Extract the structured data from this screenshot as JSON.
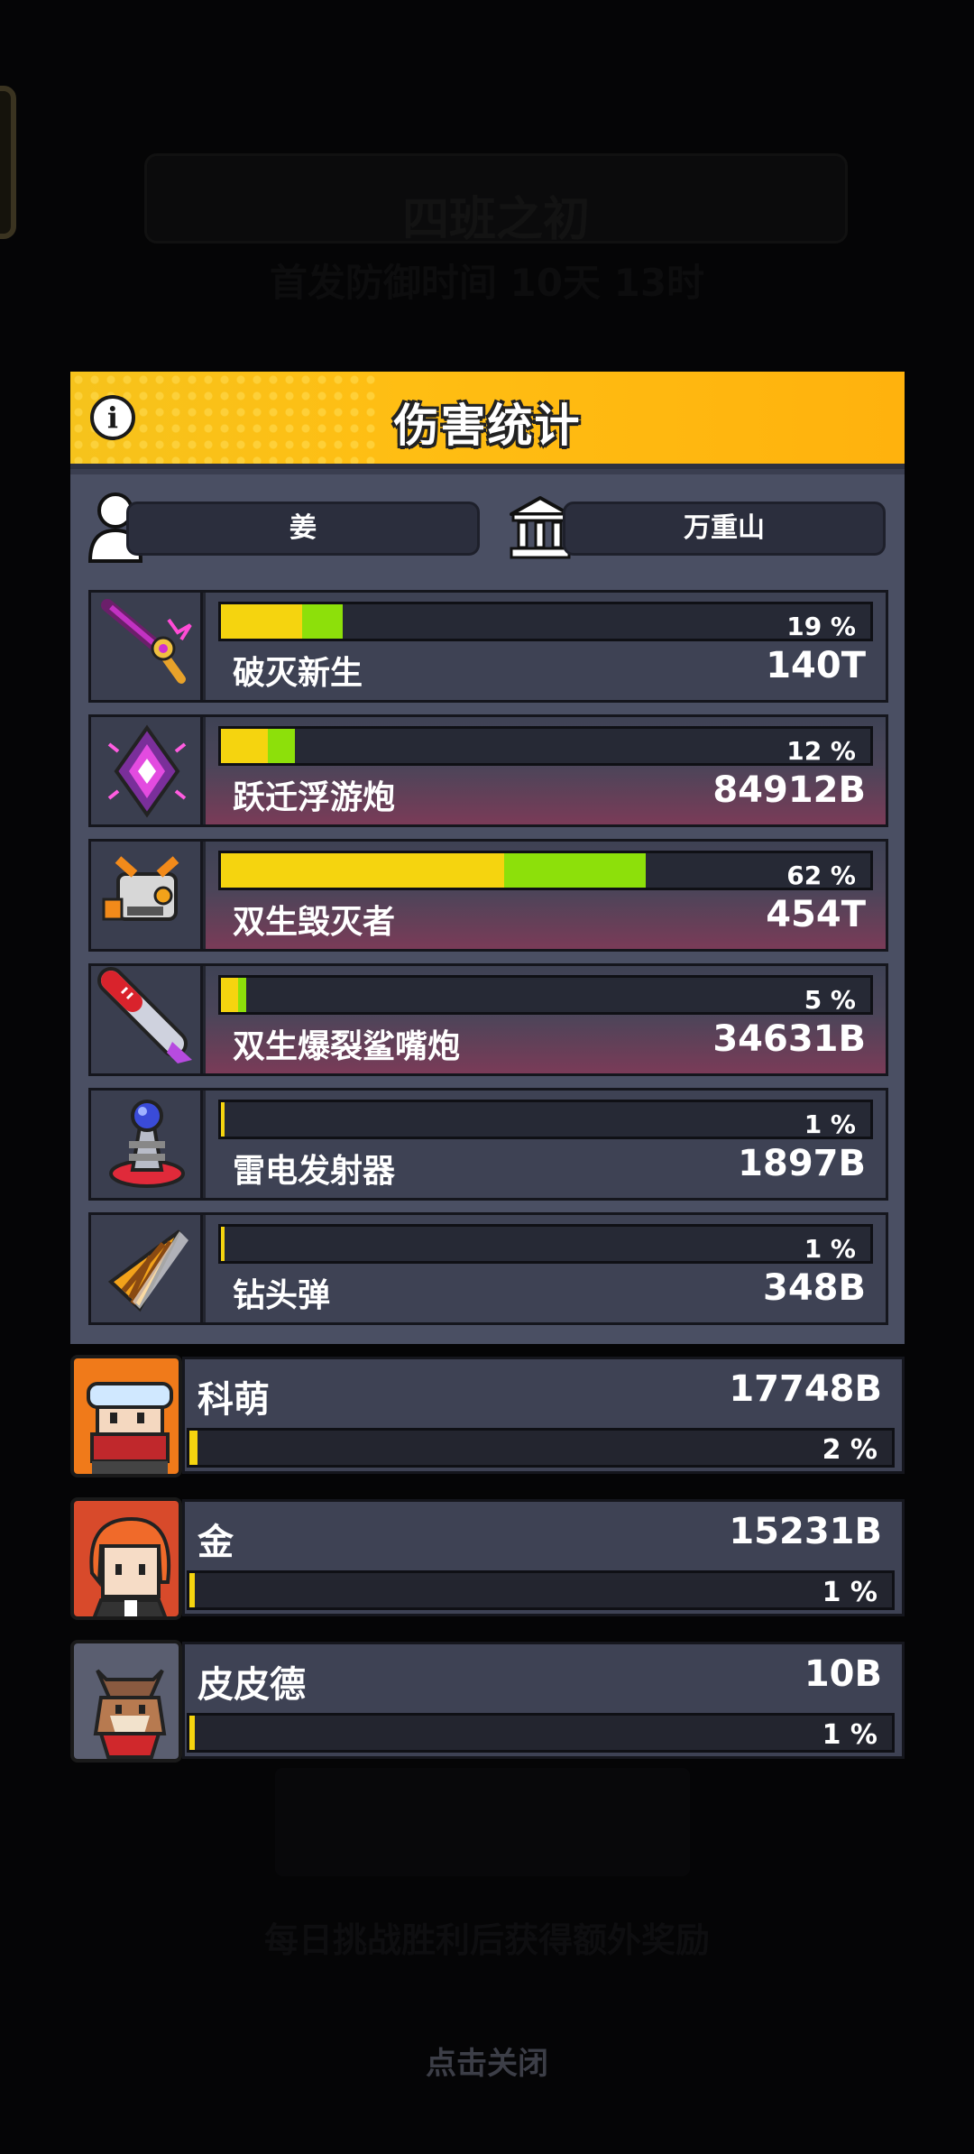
{
  "background": {
    "title": "四班之初",
    "subtitle": "首发防御时间 10天 13时",
    "bottom_line": "每日挑战胜利后获得额外奖励"
  },
  "modal": {
    "title": "伤害统计",
    "player_name": "姜",
    "guild_name": "万重山"
  },
  "weapons": [
    {
      "name": "破灭新生",
      "value": "140T",
      "percent": "19 %",
      "icon": "purple-axe-icon",
      "yellow": 0.12,
      "green": 0.06,
      "pink": false
    },
    {
      "name": "跃迁浮游炮",
      "value": "84912B",
      "percent": "12 %",
      "icon": "purple-crystal-icon",
      "yellow": 0.07,
      "green": 0.04,
      "pink": true
    },
    {
      "name": "双生毁灭者",
      "value": "454T",
      "percent": "62 %",
      "icon": "twin-destroyer-robot-icon",
      "yellow": 0.42,
      "green": 0.21,
      "pink": true
    },
    {
      "name": "双生爆裂鲨嘴炮",
      "value": "34631B",
      "percent": "5 %",
      "icon": "shark-rocket-icon",
      "yellow": 0.025,
      "green": 0.012,
      "pink": true
    },
    {
      "name": "雷电发射器",
      "value": "1897B",
      "percent": "1 %",
      "icon": "tesla-coil-icon",
      "yellow": 0.006,
      "green": 0,
      "pink": false
    },
    {
      "name": "钻头弹",
      "value": "348B",
      "percent": "1 %",
      "icon": "drill-shell-icon",
      "yellow": 0.006,
      "green": 0,
      "pink": false
    }
  ],
  "heroes": [
    {
      "name": "科萌",
      "value": "17748B",
      "percent": "2 %",
      "icon": "goggles-hero-portrait",
      "fill": 0.012,
      "bg": "#f07a1a"
    },
    {
      "name": "金",
      "value": "15231B",
      "percent": "1 %",
      "icon": "red-hair-hero-portrait",
      "fill": 0.008,
      "bg": "#d84a2b"
    },
    {
      "name": "皮皮德",
      "value": "10B",
      "percent": "1 %",
      "icon": "dog-hero-portrait",
      "fill": 0.008,
      "bg": "#5a5e70"
    }
  ],
  "close_hint": "点击关闭",
  "colors": {
    "header": "#ffbe13",
    "yellow_bar": "#f5d40f",
    "green_bar": "#8de00a"
  }
}
